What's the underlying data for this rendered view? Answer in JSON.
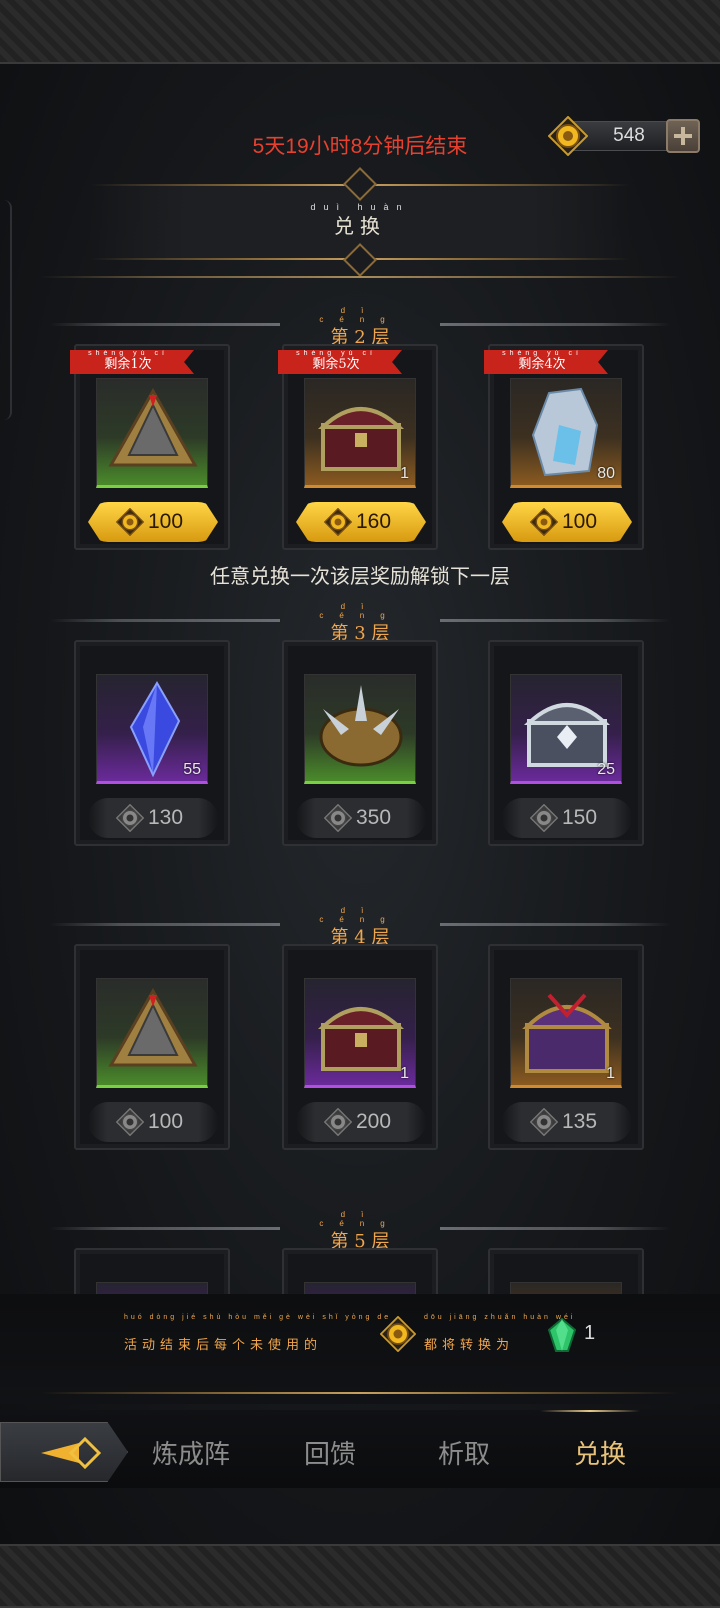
{
  "header": {
    "timer_text": "5天19小时8分钟后结束",
    "currency_amount": "548"
  },
  "banner": {
    "pinyin": "duì huàn",
    "title": "兑换"
  },
  "layers": [
    {
      "pinyin": "dì céng",
      "title": "第 2 层",
      "currency": "gold",
      "items": [
        {
          "ribbon_pinyin": "shèng yú cì",
          "ribbon": "剩余1次",
          "bg": "green",
          "icon": "gold-pyramid-relic-icon",
          "qty": "",
          "price": "100"
        },
        {
          "ribbon_pinyin": "shèng yú cì",
          "ribbon": "剩余5次",
          "bg": "orange",
          "icon": "treasure-chest-icon",
          "qty": "1",
          "price": "160"
        },
        {
          "ribbon_pinyin": "shèng yú cì",
          "ribbon": "剩余4次",
          "bg": "orange",
          "icon": "ice-crystal-ore-icon",
          "qty": "80",
          "price": "100"
        }
      ]
    },
    {
      "pinyin": "dì céng",
      "title": "第 3 层",
      "currency": "gray",
      "items": [
        {
          "bg": "purple",
          "icon": "blue-crystal-icon",
          "qty": "55",
          "price": "130"
        },
        {
          "bg": "green",
          "icon": "spiked-armor-icon",
          "qty": "",
          "price": "350"
        },
        {
          "bg": "purple",
          "icon": "silver-chest-icon",
          "qty": "25",
          "price": "150"
        }
      ]
    },
    {
      "pinyin": "dì céng",
      "title": "第 4 层",
      "currency": "gray",
      "items": [
        {
          "bg": "green",
          "icon": "gold-pyramid-relic-icon",
          "qty": "",
          "price": "100"
        },
        {
          "bg": "purple",
          "icon": "treasure-chest-icon",
          "qty": "1",
          "price": "200"
        },
        {
          "bg": "orange",
          "icon": "purple-ornate-chest-icon",
          "qty": "1",
          "price": "135"
        }
      ]
    },
    {
      "pinyin": "dì céng",
      "title": "第 5 层",
      "currency": "gray",
      "items": []
    }
  ],
  "unlock_hint": "任意兑换一次该层奖励解锁下一层",
  "notice": {
    "pinyin_a": "huó dòng jié shù hòu měi gè wèi shǐ yòng de",
    "text_a": "活动结束后每个未使用的",
    "pinyin_b": "dōu jiāng zhuǎn huàn wéi",
    "text_b": "都将转换为",
    "convert_count": "1"
  },
  "tabs": [
    "炼成阵",
    "回馈",
    "析取",
    "兑换"
  ],
  "colors": {
    "timer_red": "#e8402e",
    "accent_orange": "#f0a64c",
    "active_tab": "#e8c27a",
    "ribbon_red": "#c8241c",
    "gold_button": "#ffd646"
  }
}
